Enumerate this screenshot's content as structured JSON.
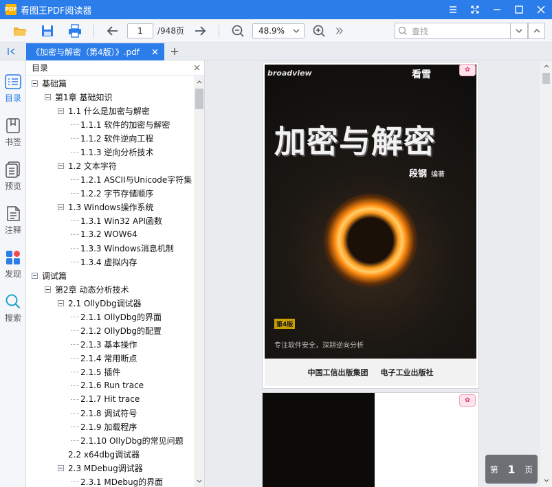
{
  "app": {
    "logo_text": "PDF",
    "title": "看图王PDF阅读器"
  },
  "toolbar": {
    "page_current": "1",
    "page_total": "/948页",
    "zoom": "48.9%",
    "search_placeholder": "查找"
  },
  "tab": {
    "title": "《加密与解密（第4版）》.pdf"
  },
  "rail": [
    {
      "label": "目录",
      "icon": "outline-list-icon"
    },
    {
      "label": "书签",
      "icon": "bookmark-icon"
    },
    {
      "label": "预览",
      "icon": "thumbnails-icon"
    },
    {
      "label": "注释",
      "icon": "annotation-icon"
    },
    {
      "label": "发现",
      "icon": "discover-apps-icon"
    },
    {
      "label": "搜索",
      "icon": "search-icon"
    }
  ],
  "outline": {
    "header": "目录",
    "items": [
      {
        "label": "基础篇",
        "level": 0,
        "expanded": true
      },
      {
        "label": "第1章 基础知识",
        "level": 1,
        "expanded": true
      },
      {
        "label": "1.1 什么是加密与解密",
        "level": 2,
        "expanded": true
      },
      {
        "label": "1.1.1 软件的加密与解密",
        "level": 3
      },
      {
        "label": "1.1.2 软件逆向工程",
        "level": 3
      },
      {
        "label": "1.1.3 逆向分析技术",
        "level": 3
      },
      {
        "label": "1.2 文本字符",
        "level": 2,
        "expanded": true
      },
      {
        "label": "1.2.1 ASCII与Unicode字符集",
        "level": 3
      },
      {
        "label": "1.2.2 字节存储顺序",
        "level": 3
      },
      {
        "label": "1.3 Windows操作系统",
        "level": 2,
        "expanded": true
      },
      {
        "label": "1.3.1 Win32 API函数",
        "level": 3
      },
      {
        "label": "1.3.2 WOW64",
        "level": 3
      },
      {
        "label": "1.3.3 Windows消息机制",
        "level": 3
      },
      {
        "label": "1.3.4 虚拟内存",
        "level": 3
      },
      {
        "label": "调试篇",
        "level": 0,
        "expanded": true
      },
      {
        "label": "第2章 动态分析技术",
        "level": 1,
        "expanded": true
      },
      {
        "label": "2.1 OllyDbg调试器",
        "level": 2,
        "expanded": true
      },
      {
        "label": "2.1.1 OllyDbg的界面",
        "level": 3
      },
      {
        "label": "2.1.2 OllyDbg的配置",
        "level": 3
      },
      {
        "label": "2.1.3 基本操作",
        "level": 3
      },
      {
        "label": "2.1.4 常用断点",
        "level": 3
      },
      {
        "label": "2.1.5 插件",
        "level": 3
      },
      {
        "label": "2.1.6 Run trace",
        "level": 3
      },
      {
        "label": "2.1.7 Hit trace",
        "level": 3
      },
      {
        "label": "2.1.8 调试符号",
        "level": 3
      },
      {
        "label": "2.1.9 加载程序",
        "level": 3
      },
      {
        "label": "2.1.10 OllyDbg的常见问题",
        "level": 3
      },
      {
        "label": "2.2 x64dbg调试器",
        "level": 2,
        "expanded": false
      },
      {
        "label": "2.3 MDebug调试器",
        "level": 2,
        "expanded": true
      },
      {
        "label": "2.3.1 MDebug的界面",
        "level": 3
      }
    ]
  },
  "cover": {
    "publisher": "broadview",
    "brand": "看雪",
    "title": "加密与解密",
    "author": "段钢",
    "author_role": "编著",
    "edition": "第4版",
    "slogan": "专注软件安全，深耕逆向分析",
    "footer_left": "中国工信出版集团",
    "footer_right": "电子工业出版社"
  },
  "page_indicator": {
    "prefix": "第",
    "number": "1",
    "suffix": "页"
  },
  "colors": {
    "accent": "#2b7de9",
    "toolbar_bg": "#f4f6f9"
  }
}
